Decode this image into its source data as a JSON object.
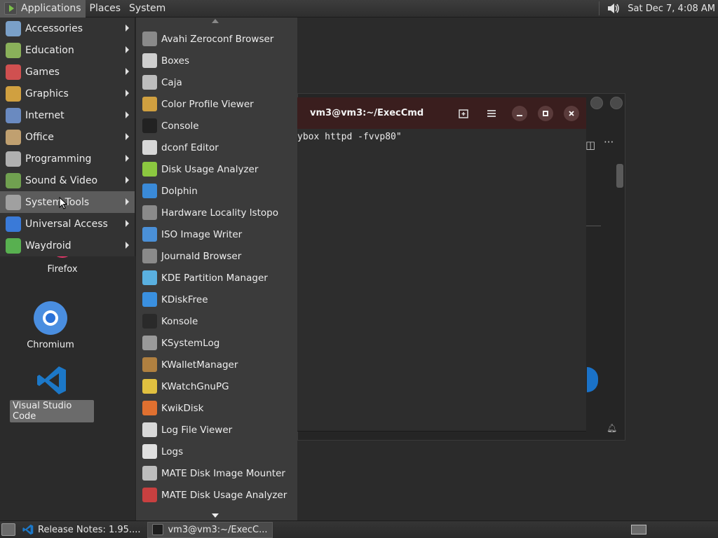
{
  "top_panel": {
    "menus": [
      {
        "label": "Applications",
        "active": true
      },
      {
        "label": "Places",
        "active": false
      },
      {
        "label": "System",
        "active": false
      }
    ],
    "clock": "Sat Dec  7,  4:08 AM",
    "volume_icon": "speaker-icon"
  },
  "desktop_icons": {
    "firefox": {
      "label": "Firefox"
    },
    "chromium": {
      "label": "Chromium"
    },
    "vscode": {
      "label": "Visual Studio Code"
    }
  },
  "terminal": {
    "title": "vm3@vm3:~/ExecCmd",
    "content_line": "ybox httpd -fvvp80\"",
    "buttons": [
      "new-tab-icon",
      "hamburger-menu-icon",
      "minimize-icon",
      "maximize-icon",
      "close-icon"
    ]
  },
  "app_menu": {
    "categories": [
      {
        "label": "Accessories",
        "icon": "accessories-icon",
        "color": "#7aa0c8"
      },
      {
        "label": "Education",
        "icon": "education-icon",
        "color": "#8ab05a"
      },
      {
        "label": "Games",
        "icon": "games-icon",
        "color": "#d05050"
      },
      {
        "label": "Graphics",
        "icon": "graphics-icon",
        "color": "#d0a040"
      },
      {
        "label": "Internet",
        "icon": "internet-icon",
        "color": "#6a8ac0"
      },
      {
        "label": "Office",
        "icon": "office-icon",
        "color": "#c0a070"
      },
      {
        "label": "Programming",
        "icon": "programming-icon",
        "color": "#b0b0b0"
      },
      {
        "label": "Sound & Video",
        "icon": "sound-video-icon",
        "color": "#70a050"
      },
      {
        "label": "System Tools",
        "icon": "system-tools-icon",
        "color": "#a0a0a0",
        "active": true
      },
      {
        "label": "Universal Access",
        "icon": "universal-access-icon",
        "color": "#3a7ad8"
      },
      {
        "label": "Waydroid",
        "icon": "waydroid-icon",
        "color": "#58b050"
      }
    ],
    "system_tools": [
      {
        "label": "Avahi Zeroconf Browser",
        "icon": "avahi-icon",
        "color": "#8a8a8a"
      },
      {
        "label": "Boxes",
        "icon": "boxes-icon",
        "color": "#cfcfcf"
      },
      {
        "label": "Caja",
        "icon": "caja-icon",
        "color": "#bdbdbd"
      },
      {
        "label": "Color Profile Viewer",
        "icon": "color-profile-icon",
        "color": "#d0a040"
      },
      {
        "label": "Console",
        "icon": "console-icon",
        "color": "#222222"
      },
      {
        "label": "dconf Editor",
        "icon": "dconf-icon",
        "color": "#d8d8d8"
      },
      {
        "label": "Disk Usage Analyzer",
        "icon": "disk-usage-icon",
        "color": "#8cc840"
      },
      {
        "label": "Dolphin",
        "icon": "dolphin-icon",
        "color": "#3a8ad8"
      },
      {
        "label": "Hardware Locality lstopo",
        "icon": "lstopo-icon",
        "color": "#8a8a8a"
      },
      {
        "label": "ISO Image Writer",
        "icon": "iso-writer-icon",
        "color": "#4a90d8"
      },
      {
        "label": "Journald Browser",
        "icon": "journald-icon",
        "color": "#8a8a8a"
      },
      {
        "label": "KDE Partition Manager",
        "icon": "partition-manager-icon",
        "color": "#5ab0e0"
      },
      {
        "label": "KDiskFree",
        "icon": "kdiskfree-icon",
        "color": "#3a90e0"
      },
      {
        "label": "Konsole",
        "icon": "konsole-icon",
        "color": "#2a2a2a"
      },
      {
        "label": "KSystemLog",
        "icon": "ksystemlog-icon",
        "color": "#9a9a9a"
      },
      {
        "label": "KWalletManager",
        "icon": "kwallet-icon",
        "color": "#b08040"
      },
      {
        "label": "KWatchGnuPG",
        "icon": "kwatchgnupg-icon",
        "color": "#e0c040"
      },
      {
        "label": "KwikDisk",
        "icon": "kwikdisk-icon",
        "color": "#e07030"
      },
      {
        "label": "Log File Viewer",
        "icon": "log-viewer-icon",
        "color": "#d8d8d8"
      },
      {
        "label": "Logs",
        "icon": "logs-icon",
        "color": "#e0e0e0"
      },
      {
        "label": "MATE Disk Image Mounter",
        "icon": "disk-mounter-icon",
        "color": "#bdbdbd"
      },
      {
        "label": "MATE Disk Usage Analyzer",
        "icon": "mate-disk-usage-icon",
        "color": "#c84040"
      }
    ]
  },
  "bottom_panel": {
    "tasks": [
      {
        "label": "Release Notes: 1.95....",
        "icon": "vscode-icon",
        "active": false
      },
      {
        "label": "vm3@vm3:~/ExecC...",
        "icon": "terminal-icon",
        "active": true
      }
    ],
    "show_desktop_icon": "show-desktop-icon",
    "workspace_icon": "workspace-switcher-icon"
  }
}
